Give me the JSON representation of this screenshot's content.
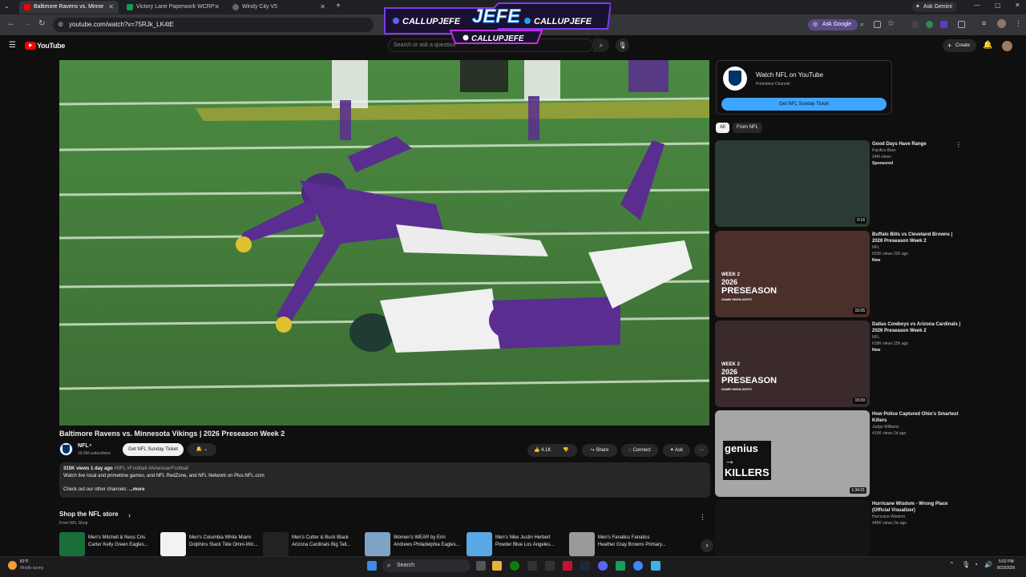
{
  "browser": {
    "tabs": [
      {
        "label": "Baltimore Ravens vs. Minne",
        "color": "#ff0000"
      },
      {
        "label": "Victory Lane Paperwork WCRP",
        "color": "#0f9d58"
      },
      {
        "label": "Windy City V5",
        "color": "#888888"
      }
    ],
    "url": "youtube.com/watch?v=75RJk_LK4tE",
    "ask_gemini": "Ask Gemini",
    "ask_google": "Ask Google"
  },
  "overlay": {
    "title": "JEFE",
    "handle_left": "CALLUPJEFE",
    "handle_right": "CALLUPJEFE",
    "handle_bottom": "CALLUPJEFE"
  },
  "youtube": {
    "logo": "YouTube",
    "search_placeholder": "Search or ask a question",
    "create_label": "Create"
  },
  "video": {
    "title": "Baltimore Ravens vs. Minnesota Vikings | 2026 Preseason Week 2",
    "channel": "NFL",
    "subscribers": "16.5M subscribers",
    "ticket_button": "Get NFL Sunday Ticket",
    "likes": "4.1K",
    "share": "Share",
    "connect": "Connect",
    "ask": "Ask",
    "description": {
      "meta": "315K views  1 day ago",
      "tags": "#NFL #Football #AmericanFootball",
      "line1": "Watch live local and primetime games, and NFL RedZone, and NFL Network on Plus.NFL.com",
      "line2": "Check out our other channels:",
      "more": "...more"
    }
  },
  "shop": {
    "title": "Shop the NFL store",
    "subtitle": "From NFL Shop",
    "items": [
      {
        "name": "Men's Mitchell & Ness Cris Carter Kelly Green Eagles...",
        "color": "#1a6e3a"
      },
      {
        "name": "Men's Columbia White Miami Dolphins Slack Tide Omni-Wic...",
        "color": "#f2f2f2"
      },
      {
        "name": "Men's Cutter & Buck Black Arizona Cardinals Big Tall...",
        "color": "#222222"
      },
      {
        "name": "Women's WEAR by Erin Andrews Philadelphia Eagles...",
        "color": "#7fa3c7"
      },
      {
        "name": "Men's Nike Justin Herbert Powder Blue Los Angeles...",
        "color": "#5aa9e6"
      },
      {
        "name": "Men's Fanatics Fanatics Heather Gray Browns Primary...",
        "color": "#9a9a9a"
      }
    ]
  },
  "sidebar": {
    "card": {
      "title": "Watch NFL on YouTube",
      "subtitle": "Primetime Channel",
      "button": "Get NFL Sunday Ticket"
    },
    "chips": [
      "All",
      "From NFL"
    ],
    "recommendations": [
      {
        "title": "Good Days Have Range",
        "channel": "Pacifico Beer",
        "meta": "34M views",
        "extra": "Sponsored",
        "duration": "0:16",
        "bg": "#2b3a34"
      },
      {
        "title": "Buffalo Bills vs Cleveland Browns | 2026 Preseason Week 2",
        "channel": "NFL",
        "meta": "633K views  23h ago",
        "extra": "New",
        "duration": "15:05",
        "bg": "#4a2f2a",
        "banner": "PRESEASON",
        "banner_top": "WEEK 2",
        "banner_year": "2026",
        "banner_sub": "GAME HIGHLIGHTS"
      },
      {
        "title": "Dallas Cowboys vs Arizona Cardinals | 2026 Preseason Week 2",
        "channel": "NFL",
        "meta": "618K views  15h ago",
        "extra": "New",
        "duration": "15:09",
        "bg": "#3a2a2c",
        "banner": "PRESEASON",
        "banner_top": "WEEK 2",
        "banner_year": "2026",
        "banner_sub": "GAME HIGHLIGHTS"
      },
      {
        "title": "How Police Captured Ohio's Smartest Killers",
        "channel": "Judge Williams",
        "meta": "419K views  1d ago",
        "extra": "",
        "duration": "1:34:21",
        "bg": "#a6a6a6",
        "banner": "genius → KILLERS"
      },
      {
        "title": "Hurricane Wisdom - Wrong Place (Official Visualizer)",
        "channel": "Hurricane Wisdom",
        "meta": "440K views  2w ago",
        "extra": "",
        "duration": "",
        "bg": "#141414"
      }
    ]
  },
  "taskbar": {
    "weather_temp": "81°F",
    "weather_text": "Mostly sunny",
    "search": "Search",
    "time": "5:02 PM",
    "date": "8/23/2026"
  }
}
